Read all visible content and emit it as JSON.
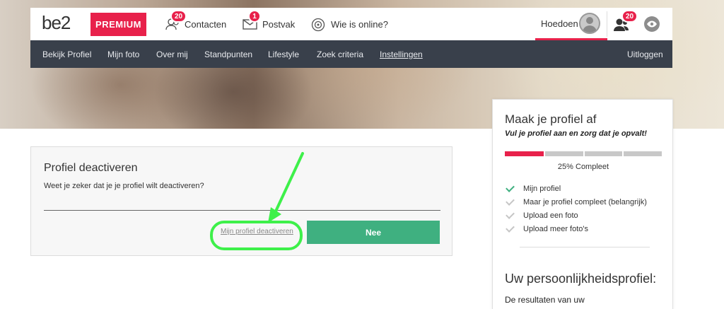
{
  "brand": {
    "logo": "be2",
    "premium_label": "PREMIUM",
    "accent_color": "#e8214b",
    "green_color": "#3fb080"
  },
  "topnav": {
    "contacts": {
      "label": "Contacten",
      "badge": "20",
      "icon": "contacts-icon"
    },
    "inbox": {
      "label": "Postvak",
      "badge": "1",
      "icon": "envelope-icon"
    },
    "online": {
      "label": "Wie is online?",
      "icon": "radar-icon"
    },
    "user_name": "Hoedoen",
    "visitors_badge": "20",
    "visitors_icon": "visitors-icon",
    "views_icon": "eye-icon"
  },
  "subnav": {
    "items": [
      {
        "label": "Bekijk Profiel"
      },
      {
        "label": "Mijn foto"
      },
      {
        "label": "Over mij"
      },
      {
        "label": "Standpunten"
      },
      {
        "label": "Lifestyle"
      },
      {
        "label": "Zoek criteria"
      },
      {
        "label": "Instellingen",
        "active": true
      }
    ],
    "logout": "Uitloggen"
  },
  "deactivate": {
    "title": "Profiel deactiveren",
    "question": "Weet je zeker dat je je profiel wilt deactiveren?",
    "confirm_link": "Mijn profiel deactiveren",
    "cancel_button": "Nee"
  },
  "profile_card": {
    "title": "Maak je profiel af",
    "subtitle": "Vul je profiel aan en zorg dat je opvalt!",
    "progress": 0.25,
    "progress_text": "25% Compleet",
    "checklist": [
      {
        "label": "Mijn profiel",
        "done": true
      },
      {
        "label": "Maar je profiel compleet (belangrijk)",
        "done": false
      },
      {
        "label": "Upload een foto",
        "done": false
      },
      {
        "label": "Upload meer foto's",
        "done": false
      }
    ],
    "personality_title": "Uw persoonlijkheidsprofiel:",
    "personality_text": "De resultaten van uw"
  }
}
